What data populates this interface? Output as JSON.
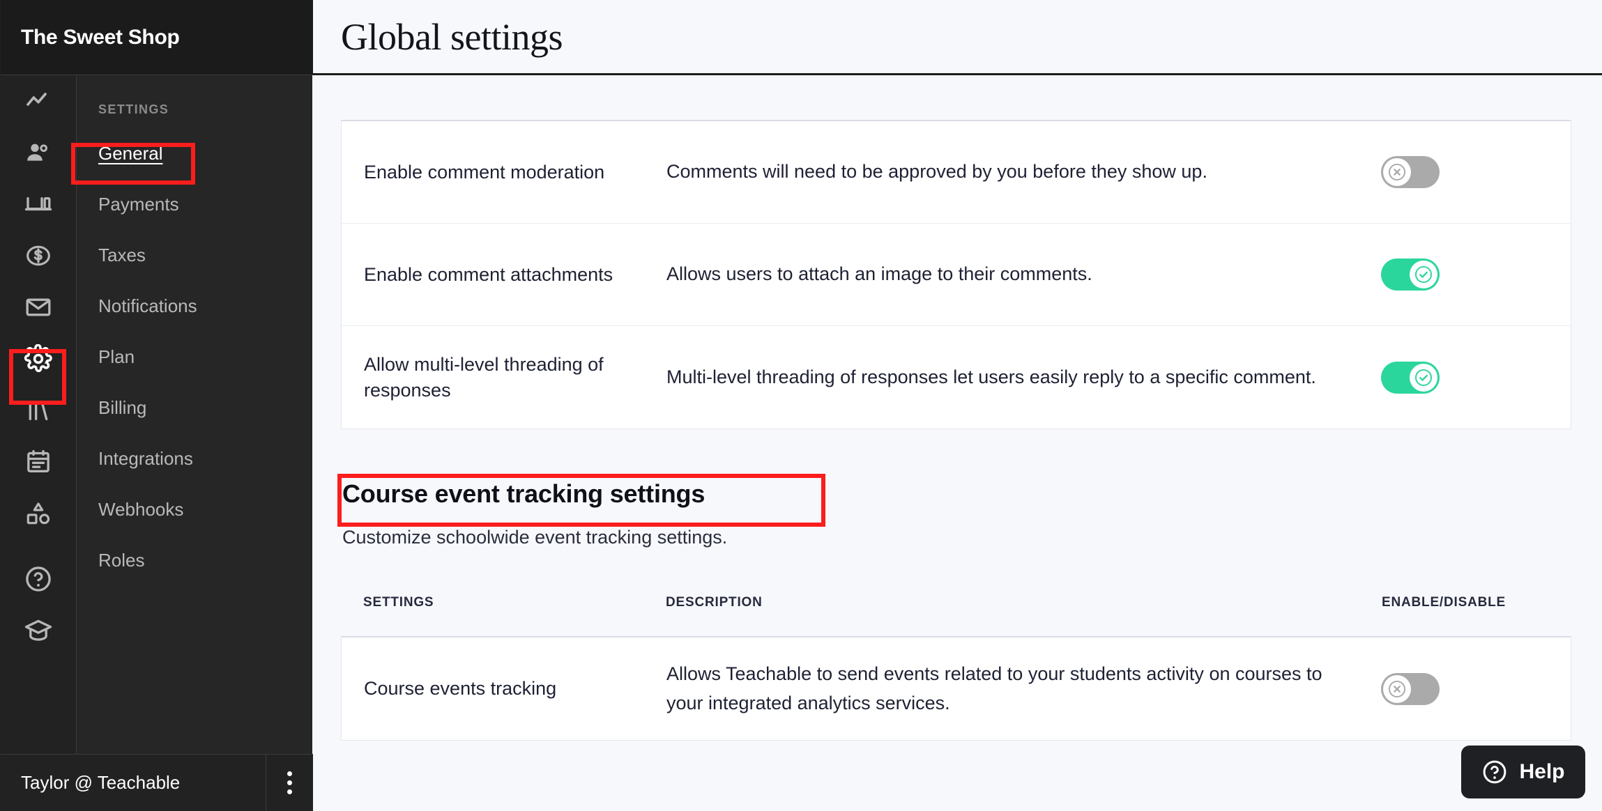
{
  "brand": {
    "title": "The Sweet Shop"
  },
  "rail": {
    "icons": [
      {
        "name": "analytics-icon"
      },
      {
        "name": "users-icon"
      },
      {
        "name": "site-icon"
      },
      {
        "name": "sales-icon"
      },
      {
        "name": "email-icon"
      },
      {
        "name": "gear-icon"
      },
      {
        "name": "library-icon"
      },
      {
        "name": "calendar-icon"
      },
      {
        "name": "shapes-icon"
      },
      {
        "name": "help-circle-icon"
      },
      {
        "name": "graduation-cap-icon"
      }
    ]
  },
  "subnav": {
    "label": "SETTINGS",
    "items": [
      {
        "label": "General",
        "active": true
      },
      {
        "label": "Payments",
        "active": false
      },
      {
        "label": "Taxes",
        "active": false
      },
      {
        "label": "Notifications",
        "active": false
      },
      {
        "label": "Plan",
        "active": false
      },
      {
        "label": "Billing",
        "active": false
      },
      {
        "label": "Integrations",
        "active": false
      },
      {
        "label": "Webhooks",
        "active": false
      },
      {
        "label": "Roles",
        "active": false
      }
    ]
  },
  "user": {
    "name": "Taylor @ Teachable",
    "menu_icon": "kebab-menu-icon"
  },
  "header": {
    "title": "Global settings"
  },
  "comment_settings": {
    "rows": [
      {
        "setting": "Enable comment moderation",
        "description": "Comments will need to be approved by you before they show up.",
        "enabled": false
      },
      {
        "setting": "Enable comment attachments",
        "description": "Allows users to attach an image to their comments.",
        "enabled": true
      },
      {
        "setting": "Allow multi-level threading of responses",
        "description": "Multi-level threading of responses let users easily reply to a specific comment.",
        "enabled": true
      }
    ]
  },
  "event_tracking": {
    "title": "Course event tracking settings",
    "subtitle": "Customize schoolwide event tracking settings.",
    "columns": {
      "settings": "SETTINGS",
      "description": "DESCRIPTION",
      "enable": "ENABLE/DISABLE"
    },
    "rows": [
      {
        "setting": "Course events tracking",
        "description": "Allows Teachable to send events related to your students activity on courses to your integrated analytics services.",
        "enabled": false
      }
    ]
  },
  "help": {
    "label": "Help",
    "icon": "question-circle-icon"
  },
  "colors": {
    "accent_green": "#2bd69c",
    "toggle_off_gray": "#aaaaaa",
    "sidebar_dark": "#222222",
    "subnav_dark": "#262626",
    "page_bg": "#f7f8fc",
    "annotation_red": "#fc1d1d",
    "text_dark": "#1e2133"
  },
  "annotations": [
    {
      "name": "highlight-general-nav"
    },
    {
      "name": "highlight-settings-gear"
    },
    {
      "name": "highlight-course-event-tracking-heading"
    }
  ]
}
